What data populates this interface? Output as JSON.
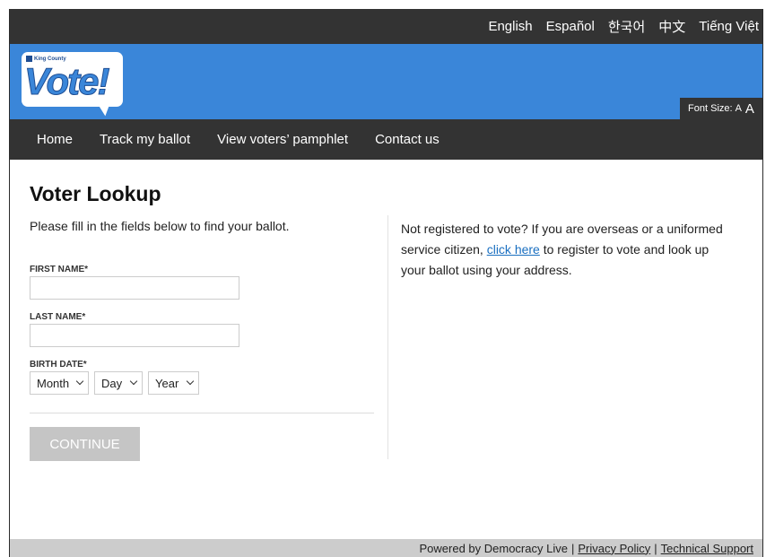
{
  "languages": [
    "English",
    "Español",
    "한국어",
    "中文",
    "Tiếng Việt"
  ],
  "logo": {
    "county_text": "King County",
    "vote_text": "Vote!"
  },
  "font_size": {
    "label": "Font Size:",
    "small": "A",
    "large": "A"
  },
  "nav": [
    "Home",
    "Track my ballot",
    "View voters’ pamphlet",
    "Contact us"
  ],
  "form": {
    "title": "Voter Lookup",
    "intro": "Please fill in the fields below to find your ballot.",
    "first_name_label": "FIRST NAME*",
    "first_name_value": "",
    "last_name_label": "LAST NAME*",
    "last_name_value": "",
    "birth_date_label": "BIRTH DATE*",
    "month": "Month",
    "day": "Day",
    "year": "Year",
    "continue": "CONTINUE"
  },
  "notice": {
    "before": "Not registered to vote? If you are overseas or a uniformed service citizen, ",
    "link": "click here",
    "after": " to register to vote and look up your ballot using your address."
  },
  "footer": {
    "powered": "Powered by Democracy Live",
    "sep1": "|",
    "privacy": "Privacy Policy",
    "sep2": "|",
    "support": "Technical Support"
  },
  "colors": {
    "brand_blue": "#3a86d9",
    "dark_bar": "#333333",
    "button_disabled": "#c5c5c5",
    "footer_bg": "#cccccc",
    "link": "#1a6fc0"
  }
}
